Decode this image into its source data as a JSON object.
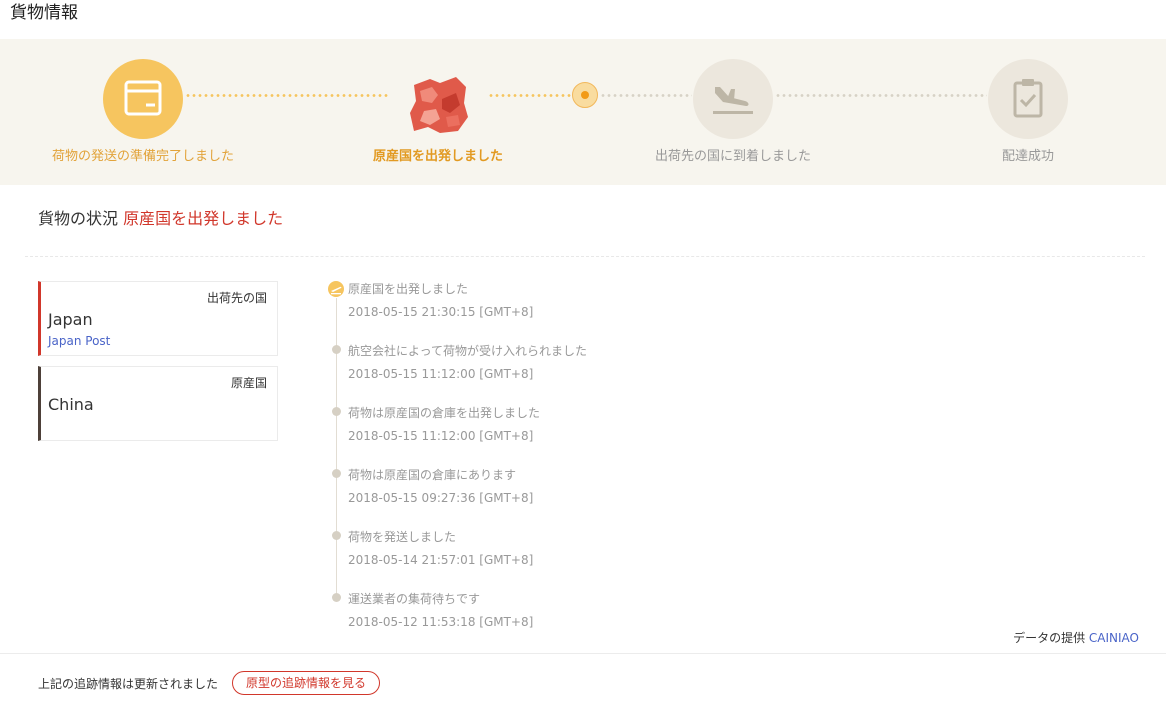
{
  "page": {
    "title": "貨物情報"
  },
  "colors": {
    "accent": "#f6c55f",
    "highlight": "#d1372b",
    "link": "#4a64c8"
  },
  "progress": {
    "steps": [
      {
        "label": "荷物の発送の準備完了しました",
        "icon": "package-icon",
        "state": "done"
      },
      {
        "label": "原産国を出発しました",
        "icon": "origin-map-icon",
        "state": "current"
      },
      {
        "label": "出荷先の国に到着しました",
        "icon": "airplane-landing-icon",
        "state": "pending"
      },
      {
        "label": "配達成功",
        "icon": "clipboard-check-icon",
        "state": "pending"
      }
    ]
  },
  "status": {
    "prefix": "貨物の状況",
    "value": "原産国を出発しました"
  },
  "destination": {
    "role": "出荷先の国",
    "country": "Japan",
    "carrier": "Japan Post"
  },
  "origin": {
    "role": "原産国",
    "country": "China"
  },
  "timeline": [
    {
      "title": "原産国を出発しました",
      "time": "2018-05-15 21:30:15 [GMT+8]"
    },
    {
      "title": "航空会社によって荷物が受け入れられました",
      "time": "2018-05-15 11:12:00 [GMT+8]"
    },
    {
      "title": "荷物は原産国の倉庫を出発しました",
      "time": "2018-05-15 11:12:00 [GMT+8]"
    },
    {
      "title": "荷物は原産国の倉庫にあります",
      "time": "2018-05-15 09:27:36 [GMT+8]"
    },
    {
      "title": "荷物を発送しました",
      "time": "2018-05-14 21:57:01 [GMT+8]"
    },
    {
      "title": "運送業者の集荷待ちです",
      "time": "2018-05-12 11:53:18 [GMT+8]"
    }
  ],
  "provider": {
    "label": "データの提供",
    "name": "CAINIAO"
  },
  "footer": {
    "updated_text": "上記の追跡情報は更新されました",
    "original_button": "原型の追跡情報を見る"
  }
}
